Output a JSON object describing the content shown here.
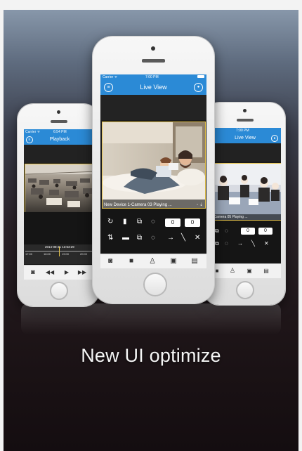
{
  "caption": "New UI optimize",
  "left_phone": {
    "carrier": "Carrier ᯤ",
    "time": "6:54 PM",
    "title": "Playback",
    "date": "2014-08-21 13:53:29",
    "ticks": [
      "17:00",
      "18:00",
      "19:00",
      "20:00"
    ],
    "tabs": [
      "camera-tab-icon",
      "rewind-icon",
      "play-icon",
      "fast-forward-icon"
    ]
  },
  "center_phone": {
    "carrier": "Carrier ᯤ",
    "time": "7:00 PM",
    "title": "Live View",
    "status_line": "New Device 1-Camera 03  Playing ...",
    "counter_a": "0",
    "counter_b": "0",
    "tabs": [
      "camera-tab-icon",
      "video-tab-icon",
      "person-tab-icon",
      "snapshot-tab-icon",
      "more-tab-icon"
    ]
  },
  "right_phone": {
    "time": "7:00 PM",
    "title": "Live View",
    "status_line": "1-Camera 05  Playing ...",
    "counter_a": "0",
    "counter_b": "0"
  },
  "colors": {
    "accent": "#2b8ad6",
    "video_border": "#e6c34a"
  }
}
